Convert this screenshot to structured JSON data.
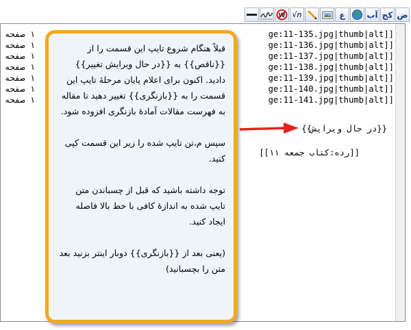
{
  "toolbar": {
    "buttons": [
      {
        "name": "bold-button",
        "label": "ض"
      },
      {
        "name": "italic-button",
        "label": "کج"
      },
      {
        "name": "internal-link-button",
        "label": "آب"
      },
      {
        "name": "external-link-button",
        "icon": "globe-icon"
      },
      {
        "name": "heading-button",
        "label": "ع"
      },
      {
        "name": "image-button",
        "icon": "image-icon"
      },
      {
        "name": "media-button",
        "icon": "pencil-media-icon"
      },
      {
        "name": "math-button",
        "label": "√n"
      },
      {
        "name": "nowiki-button",
        "icon": "no-wiki-icon"
      },
      {
        "name": "signature-button",
        "icon": "signature-icon"
      },
      {
        "name": "horizontal-line-button",
        "icon": "horizontal-line-icon"
      }
    ]
  },
  "editor": {
    "left_lines": [
      "۱ صفحه",
      "۱ صفحه",
      "۱ صفحه",
      "۱ صفحه",
      "۱ صفحه",
      "۱ صفحه",
      "۱ صفحه"
    ],
    "right_lines": [
      "ge:11-135.jpg|thumb|alt]]",
      "ge:11-136.jpg|thumb|alt]]",
      "ge:11-137.jpg|thumb|alt]]",
      "ge:11-138.jpg|thumb|alt]]",
      "ge:11-139.jpg|thumb|alt]]",
      "ge:11-140.jpg|thumb|alt]]",
      "ge:11-141.jpg|thumb|alt]]"
    ],
    "template_line": "{{در حال ویرایش}}",
    "category_line": "[[رده:کتاب جمعه ۱۱]]"
  },
  "callout": {
    "paragraphs": [
      "قبلاً هنگام شروع تایپ این قسمت را از {{ناقص}} به {{در حال ویرایش تغییر}} دادید. اکنون برای اعلام پایان مرحلهٔ تایپ این قسمت را به {{بازنگری}} تغییر دهید تا مقاله به فهرست مقالات آمادهٔ بازنگری افزوده شود.",
      "سپس م،تن تایپ شده را زیر این قسمت کپی کنید.",
      "توجه داشته باشید که قبل از چسباندن متن تایپ شده به اندازهٔ کافی با خط بالا فاصله ایجاد کنید.",
      "(یعنی بعد از {{بازنگری}} دوبار اینتر بزنید بعد متن را بچسبانید)"
    ]
  },
  "colors": {
    "callout_border": "#f5a623",
    "callout_bg": "#eef4fa",
    "arrow": "#e8201c"
  }
}
